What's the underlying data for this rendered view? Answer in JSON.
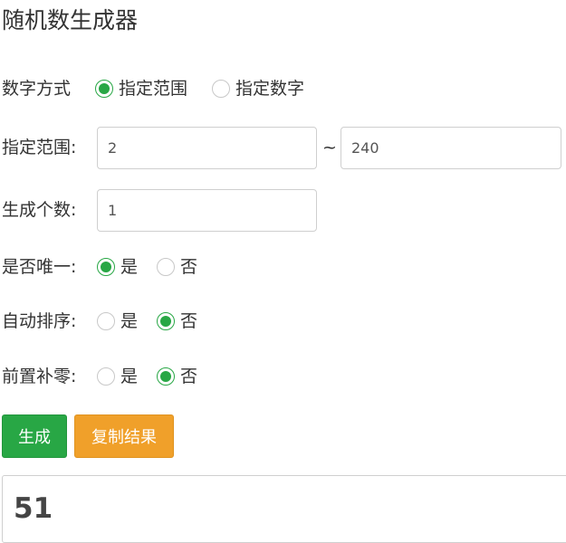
{
  "page": {
    "title": "随机数生成器"
  },
  "number_mode": {
    "label": "数字方式",
    "options": [
      {
        "label": "指定范围",
        "checked": true
      },
      {
        "label": "指定数字",
        "checked": false
      }
    ]
  },
  "range": {
    "label": "指定范围:",
    "min_value": "2",
    "separator": "~",
    "max_value": "240"
  },
  "count": {
    "label": "生成个数:",
    "value": "1"
  },
  "unique": {
    "label": "是否唯一:",
    "options": [
      {
        "label": "是",
        "checked": true
      },
      {
        "label": "否",
        "checked": false
      }
    ]
  },
  "auto_sort": {
    "label": "自动排序:",
    "options": [
      {
        "label": "是",
        "checked": false
      },
      {
        "label": "否",
        "checked": true
      }
    ]
  },
  "zero_pad": {
    "label": "前置补零:",
    "options": [
      {
        "label": "是",
        "checked": false
      },
      {
        "label": "否",
        "checked": true
      }
    ]
  },
  "buttons": {
    "generate": "生成",
    "copy": "复制结果"
  },
  "result": {
    "value": "51"
  },
  "colors": {
    "accent_green": "#28a745",
    "accent_orange": "#f0a02a"
  }
}
